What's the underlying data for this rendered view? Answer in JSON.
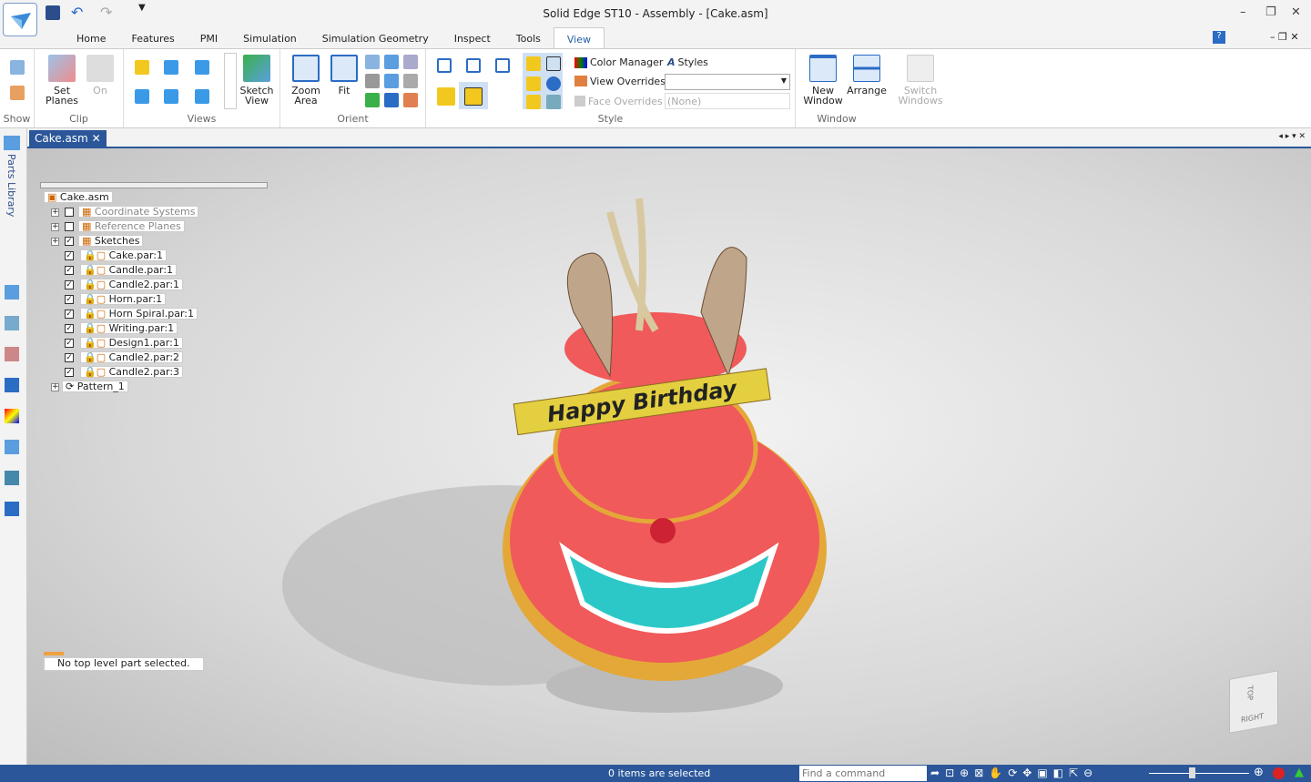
{
  "window": {
    "title": "Solid Edge ST10 - Assembly - [Cake.asm]"
  },
  "ribbon_tabs": [
    "Home",
    "Features",
    "PMI",
    "Simulation",
    "Simulation Geometry",
    "Inspect",
    "Tools",
    "View"
  ],
  "active_tab": "View",
  "groups": {
    "show": {
      "label": "Show"
    },
    "clip": {
      "label": "Clip",
      "set_planes": "Set Planes",
      "on": "On"
    },
    "views": {
      "label": "Views",
      "sketch_view": "Sketch View"
    },
    "orient": {
      "label": "Orient",
      "zoom_area": "Zoom Area",
      "fit": "Fit"
    },
    "style": {
      "label": "Style",
      "color_manager": "Color Manager",
      "styles": "Styles",
      "view_overrides": "View Overrides",
      "view_overrides_value": "",
      "face_overrides": "Face Overrides",
      "face_overrides_value": "(None)"
    },
    "window": {
      "label": "Window",
      "new_window": "New Window",
      "arrange": "Arrange",
      "switch_windows": "Switch Windows"
    }
  },
  "doc_tab": "Cake.asm",
  "side_panel": "Parts Library",
  "tree": {
    "root": "Cake.asm",
    "items": [
      {
        "label": "Coordinate Systems",
        "checked": false,
        "dim": true
      },
      {
        "label": "Reference Planes",
        "checked": false,
        "dim": true
      },
      {
        "label": "Sketches",
        "checked": true
      },
      {
        "label": "Cake.par:1",
        "checked": true
      },
      {
        "label": "Candle.par:1",
        "checked": true
      },
      {
        "label": "Candle2.par:1",
        "checked": true
      },
      {
        "label": "Horn.par:1",
        "checked": true
      },
      {
        "label": "Horn Spiral.par:1",
        "checked": true
      },
      {
        "label": "Writing.par:1",
        "checked": true
      },
      {
        "label": "Design1.par:1",
        "checked": true
      },
      {
        "label": "Candle2.par:2",
        "checked": true
      },
      {
        "label": "Candle2.par:3",
        "checked": true
      }
    ],
    "pattern": "Pattern_1"
  },
  "model_text": "Happy Birthday",
  "prompt": "No top level part selected.",
  "view_cube": {
    "top": "TOP",
    "right": "RIGHT"
  },
  "status": {
    "selection": "0 items are selected",
    "find_placeholder": "Find a command"
  }
}
